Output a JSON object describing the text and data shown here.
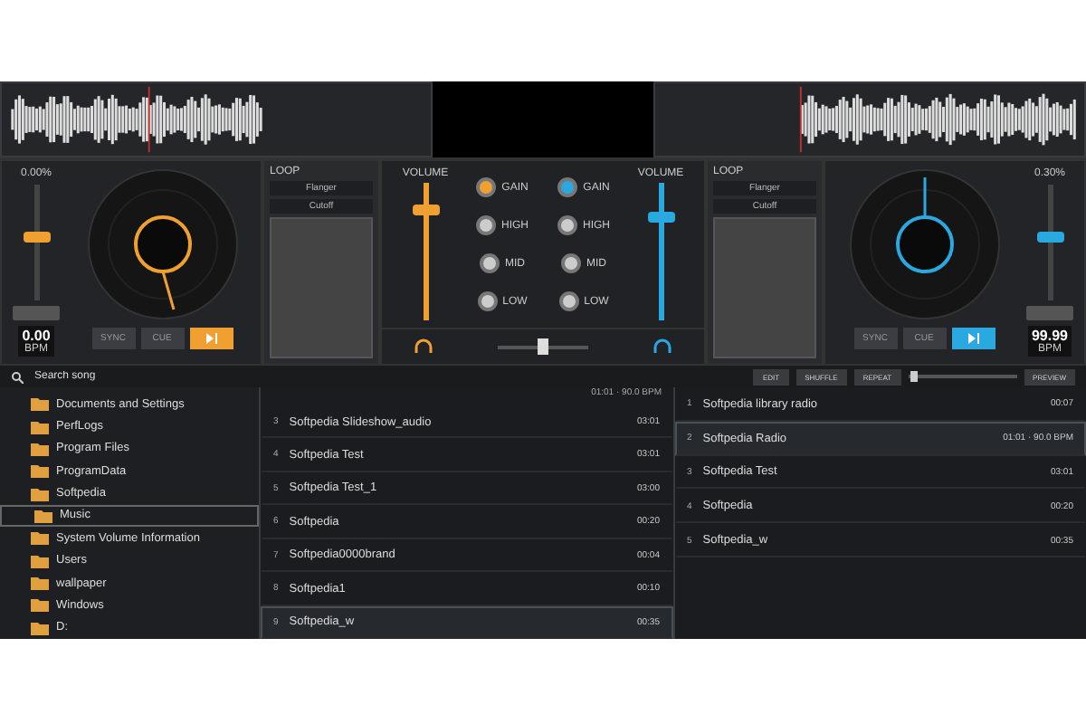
{
  "decks": [
    {
      "color": "#f0a030",
      "pitch": "0.00%",
      "pitch_slider": {
        "level": 0.55
      },
      "bpm": "0.00",
      "bpm_unit": "BPM",
      "buttons": [
        {
          "label": "SYNC",
          "kind": "text"
        },
        {
          "label": "CUE",
          "kind": "text"
        },
        {
          "kind": "play"
        }
      ],
      "fx": [
        "Flanger",
        "Cutoff"
      ],
      "loop_label": "LOOP",
      "volume": {
        "label": "VOLUME",
        "level": 0.8
      },
      "knobs": [
        "GAIN",
        "HIGH",
        "MID",
        "LOW"
      ]
    },
    {
      "color": "#2aa8e0",
      "pitch": "0.30%",
      "pitch_slider": {
        "level": 0.55
      },
      "bpm": "99.99",
      "bpm_unit": "BPM",
      "buttons": [
        {
          "label": "SYNC",
          "kind": "text"
        },
        {
          "label": "CUE",
          "kind": "text"
        },
        {
          "kind": "play"
        }
      ],
      "fx": [
        "Flanger",
        "Cutoff"
      ],
      "loop_label": "LOOP",
      "volume": {
        "label": "VOLUME",
        "level": 0.75
      },
      "knobs": [
        "GAIN",
        "HIGH",
        "MID",
        "LOW"
      ]
    }
  ],
  "mixer": {
    "crossfader": {
      "level": 0.5
    }
  },
  "toolbar": {
    "search_placeholder": "Search song",
    "buttons": [
      "EDIT",
      "SHUFFLE",
      "REPEAT"
    ],
    "preview": "PREVIEW",
    "zoom_slider": {
      "level": 0.05
    }
  },
  "folders": [
    {
      "name": "Documents and Settings",
      "selected": false
    },
    {
      "name": "PerfLogs",
      "selected": false
    },
    {
      "name": "Program Files",
      "selected": false
    },
    {
      "name": "ProgramData",
      "selected": false
    },
    {
      "name": "Softpedia",
      "selected": false,
      "children": [
        {
          "name": "Music",
          "selected": true
        }
      ]
    },
    {
      "name": "System Volume Information",
      "selected": false
    },
    {
      "name": "Users",
      "selected": false
    },
    {
      "name": "wallpaper",
      "selected": false
    },
    {
      "name": "Windows",
      "selected": false
    },
    {
      "name": "D:",
      "selected": false
    }
  ],
  "playlists": [
    {
      "header": "01:01 · 90.0 BPM",
      "rows": [
        {
          "num": "3",
          "title": "Softpedia Slideshow_audio",
          "time": "03:01",
          "selected": false
        },
        {
          "num": "4",
          "title": "Softpedia Test",
          "time": "03:01",
          "selected": false
        },
        {
          "num": "5",
          "title": "Softpedia Test_1",
          "time": "03:00",
          "selected": false
        },
        {
          "num": "6",
          "title": "Softpedia",
          "time": "00:20",
          "selected": false
        },
        {
          "num": "7",
          "title": "Softpedia0000brand",
          "time": "00:04",
          "selected": false
        },
        {
          "num": "8",
          "title": "Softpedia1",
          "time": "00:10",
          "selected": false
        },
        {
          "num": "9",
          "title": "Softpedia_w",
          "time": "00:35",
          "selected": true
        }
      ]
    },
    {
      "rows": [
        {
          "num": "1",
          "title": "Softpedia library radio",
          "time": "00:07",
          "selected": false
        },
        {
          "num": "2",
          "title": "Softpedia Radio",
          "time": "01:01 · 90.0 BPM",
          "selected": true
        },
        {
          "num": "3",
          "title": "Softpedia Test",
          "time": "03:01",
          "selected": false
        },
        {
          "num": "4",
          "title": "Softpedia",
          "time": "00:20",
          "selected": false
        },
        {
          "num": "5",
          "title": "Softpedia_w",
          "time": "00:35",
          "selected": false
        }
      ]
    }
  ]
}
